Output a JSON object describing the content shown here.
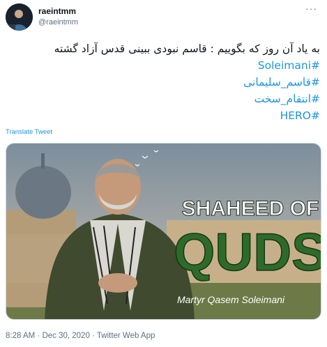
{
  "user": {
    "display_name": "raeintmm",
    "handle": "@raeintmm"
  },
  "menu": {
    "more_label": "···"
  },
  "tweet": {
    "line1": "به یاد آن روز که بگوییم : قاسم نبودی ببینی قدس آزاد گشته",
    "hashtag1": "#Soleimani",
    "hashtag2": "#قاسم_سلیمانی",
    "hashtag3": "#انتقام_سخت",
    "hashtag4": "#HERO"
  },
  "translate_label": "Translate Tweet",
  "image": {
    "headline1": "SHAHEED OF",
    "headline2": "QUDS",
    "caption": "Martyr Qasem Soleimani"
  },
  "meta": {
    "time": "8:28 AM",
    "date": "Dec 30, 2020",
    "source": "Twitter Web App",
    "separator": " · "
  },
  "colors": {
    "link": "#1b95e0",
    "secondary_text": "#5b7083",
    "headline_text": "#ffffff",
    "headline_fill": "#2e6b2a"
  },
  "icons": {
    "more": "more-horizontal-icon"
  }
}
